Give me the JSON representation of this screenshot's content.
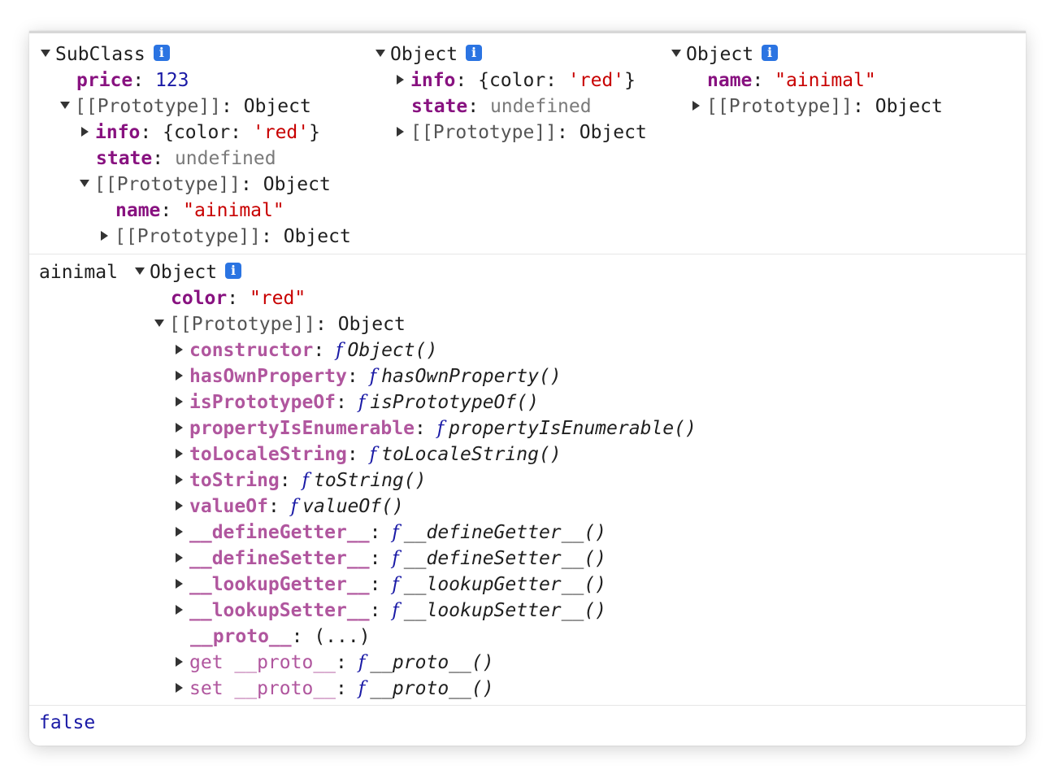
{
  "block1": {
    "col1": {
      "header": "SubClass",
      "price_key": "price",
      "price_val": "123",
      "proto1_key": "[[Prototype]]",
      "proto1_val": "Object",
      "info_key": "info",
      "info_val_open": "{color: ",
      "info_val_str": "'red'",
      "info_val_close": "}",
      "state_key": "state",
      "state_val": "undefined",
      "proto2_key": "[[Prototype]]",
      "proto2_val": "Object",
      "name_key": "name",
      "name_val": "\"ainimal\"",
      "proto3_key": "[[Prototype]]",
      "proto3_val": "Object"
    },
    "col2": {
      "header": "Object",
      "info_key": "info",
      "info_val_open": "{color: ",
      "info_val_str": "'red'",
      "info_val_close": "}",
      "state_key": "state",
      "state_val": "undefined",
      "proto_key": "[[Prototype]]",
      "proto_val": "Object"
    },
    "col3": {
      "header": "Object",
      "name_key": "name",
      "name_val": "\"ainimal\"",
      "proto_key": "[[Prototype]]",
      "proto_val": "Object"
    }
  },
  "block2": {
    "label": "ainimal",
    "header": "Object",
    "color_key": "color",
    "color_val": "\"red\"",
    "proto_key": "[[Prototype]]",
    "proto_val": "Object",
    "methods": [
      {
        "key": "constructor",
        "fn": "Object()"
      },
      {
        "key": "hasOwnProperty",
        "fn": "hasOwnProperty()"
      },
      {
        "key": "isPrototypeOf",
        "fn": "isPrototypeOf()"
      },
      {
        "key": "propertyIsEnumerable",
        "fn": "propertyIsEnumerable()"
      },
      {
        "key": "toLocaleString",
        "fn": "toLocaleString()"
      },
      {
        "key": "toString",
        "fn": "toString()"
      },
      {
        "key": "valueOf",
        "fn": "valueOf()"
      },
      {
        "key": "__defineGetter__",
        "fn": "__defineGetter__()"
      },
      {
        "key": "__defineSetter__",
        "fn": "__defineSetter__()"
      },
      {
        "key": "__lookupGetter__",
        "fn": "__lookupGetter__()"
      },
      {
        "key": "__lookupSetter__",
        "fn": "__lookupSetter__()"
      }
    ],
    "proto_accessor_key": "__proto__",
    "proto_accessor_val": "(...)",
    "get_key": "get __proto__",
    "get_fn": "__proto__()",
    "set_key": "set __proto__",
    "set_fn": "__proto__()",
    "f_symbol": "f"
  },
  "block3": {
    "value": "false"
  }
}
